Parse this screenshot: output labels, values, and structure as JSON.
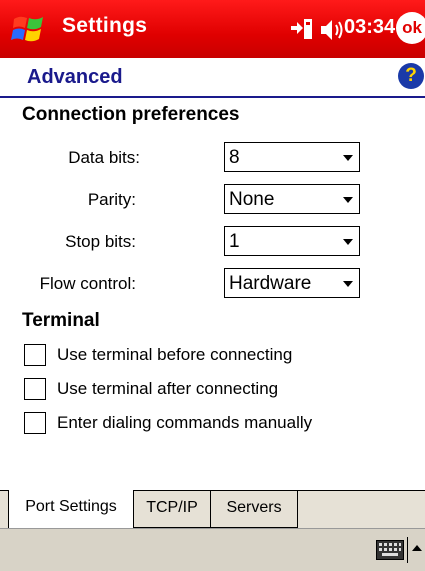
{
  "titlebar": {
    "title": "Settings",
    "time": "03:34",
    "ok_label": "ok",
    "start_icon": "windows-flag-icon",
    "connectivity_icon": "connectivity-icon",
    "volume_icon": "speaker-icon",
    "color": "#e00000"
  },
  "header": {
    "title": "Advanced",
    "help_label": "?",
    "color": "#1a1a8c"
  },
  "connection": {
    "heading": "Connection preferences",
    "fields": [
      {
        "label": "Data bits:",
        "value": "8"
      },
      {
        "label": "Parity:",
        "value": "None"
      },
      {
        "label": "Stop bits:",
        "value": "1"
      },
      {
        "label": "Flow control:",
        "value": "Hardware"
      }
    ]
  },
  "terminal": {
    "heading": "Terminal",
    "options": [
      {
        "label": "Use terminal before connecting",
        "checked": false
      },
      {
        "label": "Use terminal after connecting",
        "checked": false
      },
      {
        "label": "Enter dialing commands manually",
        "checked": false
      }
    ]
  },
  "tabs": [
    {
      "label": "Port Settings",
      "active": true
    },
    {
      "label": "TCP/IP",
      "active": false
    },
    {
      "label": "Servers",
      "active": false
    }
  ],
  "bottombar": {
    "input_icon": "keyboard-icon",
    "menu_icon": "up-arrow-icon"
  }
}
